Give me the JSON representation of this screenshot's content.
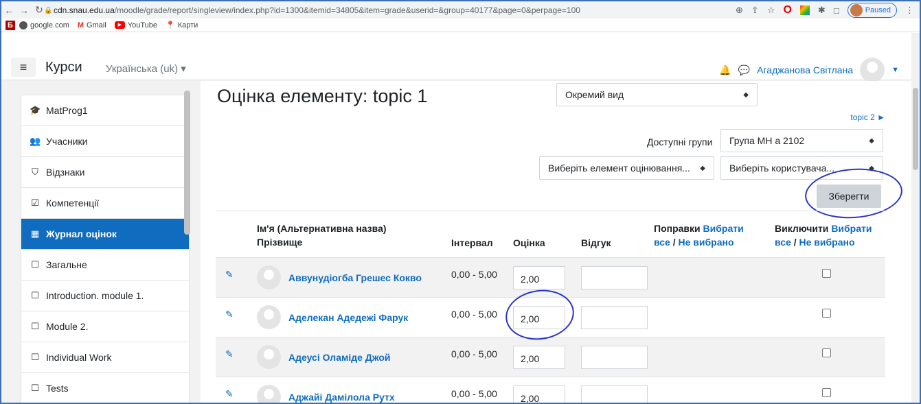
{
  "browser": {
    "url_host": "cdn.snau.edu.ua",
    "url_path": "/moodle/grade/report/singleview/index.php?id=1300&itemid=34805&item=grade&userid=&group=40177&page=0&perpage=100",
    "paused_label": "Paused",
    "bookmarks": [
      "google.com",
      "Gmail",
      "YouTube",
      "Карти"
    ]
  },
  "navbar": {
    "brand": "Курси",
    "language": "Українська (uk) ▾",
    "user_name": "Агаджанова Світлана"
  },
  "sidebar": {
    "items": [
      {
        "label": "MatProg1",
        "icon": "graduation-cap-icon",
        "glyph": "🎓"
      },
      {
        "label": "Учасники",
        "icon": "users-icon",
        "glyph": "👥"
      },
      {
        "label": "Відзнаки",
        "icon": "shield-icon",
        "glyph": "⛉"
      },
      {
        "label": "Компетенції",
        "icon": "checkbox-icon",
        "glyph": "☑"
      },
      {
        "label": "Журнал оцінок",
        "icon": "table-icon",
        "glyph": "▦"
      },
      {
        "label": "Загальне",
        "icon": "folder-icon",
        "glyph": "☐"
      },
      {
        "label": "Introduction. module 1.",
        "icon": "folder-icon",
        "glyph": "☐"
      },
      {
        "label": "Module 2.",
        "icon": "folder-icon",
        "glyph": "☐"
      },
      {
        "label": "Individual Work",
        "icon": "folder-icon",
        "glyph": "☐"
      },
      {
        "label": "Tests",
        "icon": "folder-icon",
        "glyph": "☐"
      }
    ],
    "active_index": 4
  },
  "main": {
    "title": "Оцінка елементу: topic 1",
    "view_select": "Окремий вид",
    "next_link": "topic 2 ►",
    "groups_label": "Доступні групи",
    "group_select": "Група МН а 2102",
    "grade_item_select": "Виберіть елемент оцінювання...",
    "user_select": "Виберіть користувача...",
    "save_button": "Зберегти",
    "headers": {
      "name_line1": "Ім'я (Альтернативна назва)",
      "name_line2": "Прізвище",
      "range": "Інтервал",
      "grade": "Оцінка",
      "feedback": "Відгук",
      "override": "Поправки",
      "exclude": "Виключити",
      "select_all": "Вибрати все",
      "select_none": "Не вибрано"
    },
    "rows": [
      {
        "name": "Аввунудіогба Грешес Кокво",
        "range": "0,00 - 5,00",
        "grade": "2,00"
      },
      {
        "name": "Аделекан Адедежі Фарук",
        "range": "0,00 - 5,00",
        "grade": "2,00"
      },
      {
        "name": "Адеусі Оламіде Джой",
        "range": "0,00 - 5,00",
        "grade": "2,00"
      },
      {
        "name": "Аджайі Дамілола Рутх",
        "range": "0,00 - 5,00",
        "grade": "2,00"
      }
    ]
  },
  "colors": {
    "accent": "#0f6cbf",
    "annotation": "#2b34c7"
  }
}
